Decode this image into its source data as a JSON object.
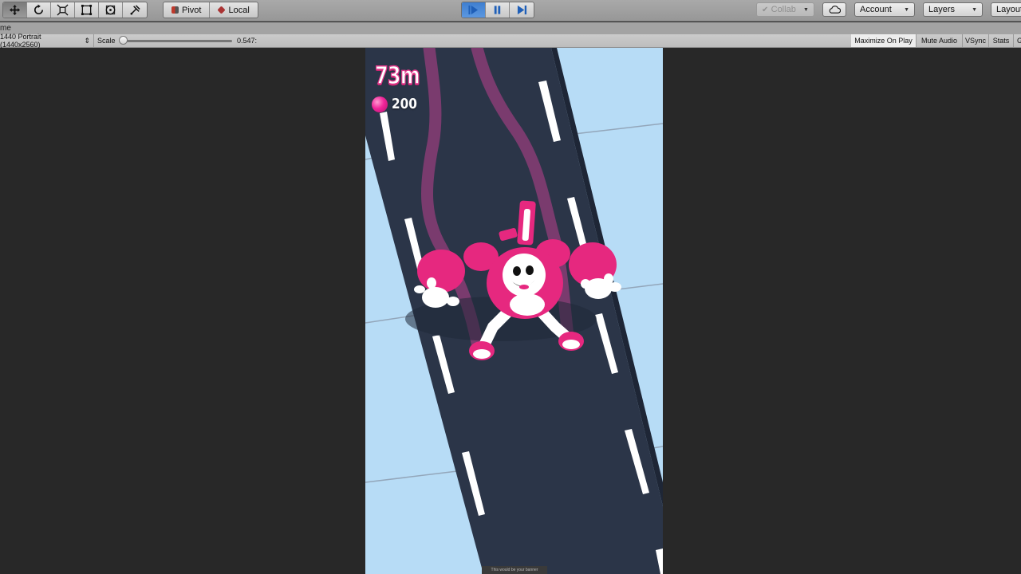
{
  "toolbar": {
    "transform_tools": [
      {
        "icon": "move-icon",
        "active": true
      },
      {
        "icon": "rotate-icon",
        "active": false
      },
      {
        "icon": "scale-icon",
        "active": false
      },
      {
        "icon": "rect-tool-icon",
        "active": false
      },
      {
        "icon": "transform-tool-icon",
        "active": false
      },
      {
        "icon": "custom-tool-icon",
        "active": false
      }
    ],
    "pivot_label": "Pivot",
    "local_label": "Local",
    "playback": {
      "play_icon": "play-icon",
      "pause_icon": "pause-icon",
      "step_icon": "step-icon",
      "playing": true
    },
    "collab_label": "Collab",
    "cloud_icon": "cloud-icon",
    "account_label": "Account",
    "layers_label": "Layers",
    "layout_label": "Layout"
  },
  "tab": {
    "label": "me"
  },
  "game_view": {
    "resolution": "1440 Portrait (1440x2560)",
    "scale_label": "Scale",
    "scale_value": "0.547:",
    "maximize_on_play": "Maximize On Play",
    "mute_audio": "Mute Audio",
    "vsync": "VSync",
    "stats": "Stats",
    "gizmos": "G"
  },
  "game": {
    "distance": "73m",
    "gem_count": "200",
    "banner_text": "This would be your banner",
    "colors": {
      "road": "#2b3548",
      "sky": "#b7dcf6",
      "accent": "#e6287f",
      "trail": "#7a3b6e"
    }
  }
}
